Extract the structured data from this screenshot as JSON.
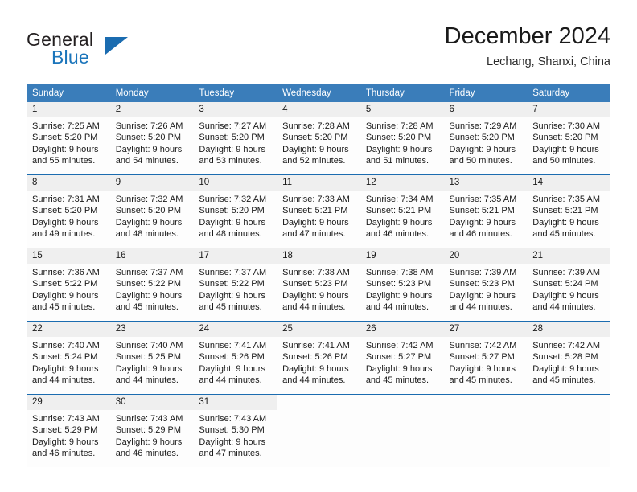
{
  "brand": {
    "name_part1": "General",
    "name_part2": "Blue",
    "logo_icon": "triangle-logo-icon"
  },
  "header": {
    "month_title": "December 2024",
    "location": "Lechang, Shanxi, China"
  },
  "calendar": {
    "weekday_headers": [
      "Sunday",
      "Monday",
      "Tuesday",
      "Wednesday",
      "Thursday",
      "Friday",
      "Saturday"
    ],
    "accent_color": "#3a7dba",
    "border_color": "#1b6cb0",
    "daynum_bg": "#efefef",
    "weeks": [
      [
        {
          "day": "1",
          "sunrise": "Sunrise: 7:25 AM",
          "sunset": "Sunset: 5:20 PM",
          "daylight1": "Daylight: 9 hours",
          "daylight2": "and 55 minutes."
        },
        {
          "day": "2",
          "sunrise": "Sunrise: 7:26 AM",
          "sunset": "Sunset: 5:20 PM",
          "daylight1": "Daylight: 9 hours",
          "daylight2": "and 54 minutes."
        },
        {
          "day": "3",
          "sunrise": "Sunrise: 7:27 AM",
          "sunset": "Sunset: 5:20 PM",
          "daylight1": "Daylight: 9 hours",
          "daylight2": "and 53 minutes."
        },
        {
          "day": "4",
          "sunrise": "Sunrise: 7:28 AM",
          "sunset": "Sunset: 5:20 PM",
          "daylight1": "Daylight: 9 hours",
          "daylight2": "and 52 minutes."
        },
        {
          "day": "5",
          "sunrise": "Sunrise: 7:28 AM",
          "sunset": "Sunset: 5:20 PM",
          "daylight1": "Daylight: 9 hours",
          "daylight2": "and 51 minutes."
        },
        {
          "day": "6",
          "sunrise": "Sunrise: 7:29 AM",
          "sunset": "Sunset: 5:20 PM",
          "daylight1": "Daylight: 9 hours",
          "daylight2": "and 50 minutes."
        },
        {
          "day": "7",
          "sunrise": "Sunrise: 7:30 AM",
          "sunset": "Sunset: 5:20 PM",
          "daylight1": "Daylight: 9 hours",
          "daylight2": "and 50 minutes."
        }
      ],
      [
        {
          "day": "8",
          "sunrise": "Sunrise: 7:31 AM",
          "sunset": "Sunset: 5:20 PM",
          "daylight1": "Daylight: 9 hours",
          "daylight2": "and 49 minutes."
        },
        {
          "day": "9",
          "sunrise": "Sunrise: 7:32 AM",
          "sunset": "Sunset: 5:20 PM",
          "daylight1": "Daylight: 9 hours",
          "daylight2": "and 48 minutes."
        },
        {
          "day": "10",
          "sunrise": "Sunrise: 7:32 AM",
          "sunset": "Sunset: 5:20 PM",
          "daylight1": "Daylight: 9 hours",
          "daylight2": "and 48 minutes."
        },
        {
          "day": "11",
          "sunrise": "Sunrise: 7:33 AM",
          "sunset": "Sunset: 5:21 PM",
          "daylight1": "Daylight: 9 hours",
          "daylight2": "and 47 minutes."
        },
        {
          "day": "12",
          "sunrise": "Sunrise: 7:34 AM",
          "sunset": "Sunset: 5:21 PM",
          "daylight1": "Daylight: 9 hours",
          "daylight2": "and 46 minutes."
        },
        {
          "day": "13",
          "sunrise": "Sunrise: 7:35 AM",
          "sunset": "Sunset: 5:21 PM",
          "daylight1": "Daylight: 9 hours",
          "daylight2": "and 46 minutes."
        },
        {
          "day": "14",
          "sunrise": "Sunrise: 7:35 AM",
          "sunset": "Sunset: 5:21 PM",
          "daylight1": "Daylight: 9 hours",
          "daylight2": "and 45 minutes."
        }
      ],
      [
        {
          "day": "15",
          "sunrise": "Sunrise: 7:36 AM",
          "sunset": "Sunset: 5:22 PM",
          "daylight1": "Daylight: 9 hours",
          "daylight2": "and 45 minutes."
        },
        {
          "day": "16",
          "sunrise": "Sunrise: 7:37 AM",
          "sunset": "Sunset: 5:22 PM",
          "daylight1": "Daylight: 9 hours",
          "daylight2": "and 45 minutes."
        },
        {
          "day": "17",
          "sunrise": "Sunrise: 7:37 AM",
          "sunset": "Sunset: 5:22 PM",
          "daylight1": "Daylight: 9 hours",
          "daylight2": "and 45 minutes."
        },
        {
          "day": "18",
          "sunrise": "Sunrise: 7:38 AM",
          "sunset": "Sunset: 5:23 PM",
          "daylight1": "Daylight: 9 hours",
          "daylight2": "and 44 minutes."
        },
        {
          "day": "19",
          "sunrise": "Sunrise: 7:38 AM",
          "sunset": "Sunset: 5:23 PM",
          "daylight1": "Daylight: 9 hours",
          "daylight2": "and 44 minutes."
        },
        {
          "day": "20",
          "sunrise": "Sunrise: 7:39 AM",
          "sunset": "Sunset: 5:23 PM",
          "daylight1": "Daylight: 9 hours",
          "daylight2": "and 44 minutes."
        },
        {
          "day": "21",
          "sunrise": "Sunrise: 7:39 AM",
          "sunset": "Sunset: 5:24 PM",
          "daylight1": "Daylight: 9 hours",
          "daylight2": "and 44 minutes."
        }
      ],
      [
        {
          "day": "22",
          "sunrise": "Sunrise: 7:40 AM",
          "sunset": "Sunset: 5:24 PM",
          "daylight1": "Daylight: 9 hours",
          "daylight2": "and 44 minutes."
        },
        {
          "day": "23",
          "sunrise": "Sunrise: 7:40 AM",
          "sunset": "Sunset: 5:25 PM",
          "daylight1": "Daylight: 9 hours",
          "daylight2": "and 44 minutes."
        },
        {
          "day": "24",
          "sunrise": "Sunrise: 7:41 AM",
          "sunset": "Sunset: 5:26 PM",
          "daylight1": "Daylight: 9 hours",
          "daylight2": "and 44 minutes."
        },
        {
          "day": "25",
          "sunrise": "Sunrise: 7:41 AM",
          "sunset": "Sunset: 5:26 PM",
          "daylight1": "Daylight: 9 hours",
          "daylight2": "and 44 minutes."
        },
        {
          "day": "26",
          "sunrise": "Sunrise: 7:42 AM",
          "sunset": "Sunset: 5:27 PM",
          "daylight1": "Daylight: 9 hours",
          "daylight2": "and 45 minutes."
        },
        {
          "day": "27",
          "sunrise": "Sunrise: 7:42 AM",
          "sunset": "Sunset: 5:27 PM",
          "daylight1": "Daylight: 9 hours",
          "daylight2": "and 45 minutes."
        },
        {
          "day": "28",
          "sunrise": "Sunrise: 7:42 AM",
          "sunset": "Sunset: 5:28 PM",
          "daylight1": "Daylight: 9 hours",
          "daylight2": "and 45 minutes."
        }
      ],
      [
        {
          "day": "29",
          "sunrise": "Sunrise: 7:43 AM",
          "sunset": "Sunset: 5:29 PM",
          "daylight1": "Daylight: 9 hours",
          "daylight2": "and 46 minutes."
        },
        {
          "day": "30",
          "sunrise": "Sunrise: 7:43 AM",
          "sunset": "Sunset: 5:29 PM",
          "daylight1": "Daylight: 9 hours",
          "daylight2": "and 46 minutes."
        },
        {
          "day": "31",
          "sunrise": "Sunrise: 7:43 AM",
          "sunset": "Sunset: 5:30 PM",
          "daylight1": "Daylight: 9 hours",
          "daylight2": "and 47 minutes."
        },
        {
          "day": "",
          "sunrise": "",
          "sunset": "",
          "daylight1": "",
          "daylight2": ""
        },
        {
          "day": "",
          "sunrise": "",
          "sunset": "",
          "daylight1": "",
          "daylight2": ""
        },
        {
          "day": "",
          "sunrise": "",
          "sunset": "",
          "daylight1": "",
          "daylight2": ""
        },
        {
          "day": "",
          "sunrise": "",
          "sunset": "",
          "daylight1": "",
          "daylight2": ""
        }
      ]
    ]
  }
}
